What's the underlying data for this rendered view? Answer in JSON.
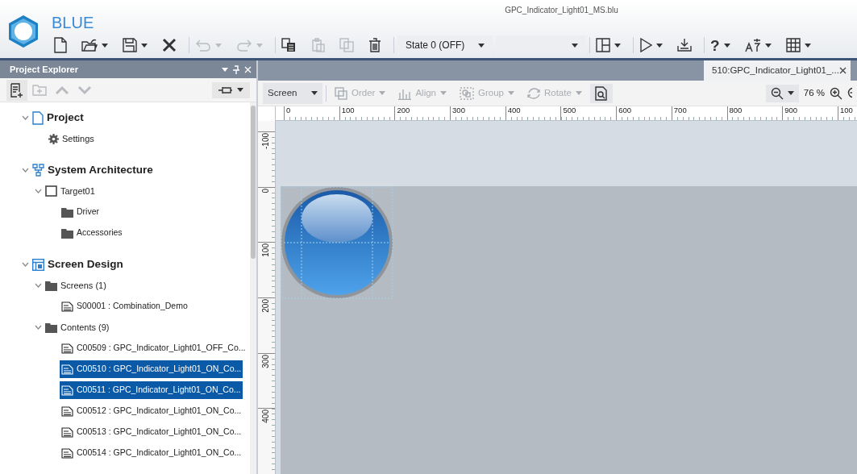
{
  "app": {
    "name": "BLUE",
    "file_title": "GPC_Indicator_Light01_MS.blu"
  },
  "toolbar": [
    {
      "kind": "new",
      "dropdown": false,
      "disabled": false
    },
    {
      "kind": "open",
      "dropdown": true,
      "disabled": false
    },
    {
      "kind": "save",
      "dropdown": true,
      "disabled": false
    },
    {
      "kind": "close",
      "dropdown": false,
      "disabled": false
    },
    {
      "kind": "separator"
    },
    {
      "kind": "undo",
      "dropdown": true,
      "disabled": true
    },
    {
      "kind": "redo",
      "dropdown": true,
      "disabled": true
    },
    {
      "kind": "separator"
    },
    {
      "kind": "copy",
      "dropdown": false,
      "disabled": false
    },
    {
      "kind": "paste",
      "dropdown": false,
      "disabled": true
    },
    {
      "kind": "duplicate",
      "dropdown": false,
      "disabled": true
    },
    {
      "kind": "delete",
      "dropdown": false,
      "disabled": false
    },
    {
      "kind": "separator"
    },
    {
      "kind": "select",
      "value": "State 0 (OFF)"
    },
    {
      "kind": "select"
    },
    {
      "kind": "separator"
    },
    {
      "kind": "layout",
      "dropdown": true,
      "disabled": false
    },
    {
      "kind": "separator"
    },
    {
      "kind": "run",
      "dropdown": true,
      "disabled": false
    },
    {
      "kind": "download",
      "dropdown": false,
      "disabled": false
    },
    {
      "kind": "separator"
    },
    {
      "kind": "help",
      "label": "?",
      "dropdown": true,
      "disabled": false
    },
    {
      "kind": "language",
      "dropdown": true,
      "disabled": false
    },
    {
      "kind": "grid",
      "dropdown": true,
      "disabled": false
    }
  ],
  "explorer": {
    "title": "Project Explorer",
    "toolbar": [
      {
        "kind": "new-item",
        "disabled": false
      },
      {
        "kind": "add-folder",
        "disabled": true
      },
      {
        "kind": "up",
        "disabled": true
      },
      {
        "kind": "down",
        "disabled": true
      }
    ],
    "tree": [
      {
        "label": "Project",
        "kind": "project",
        "expanded": true,
        "children": [
          {
            "label": "Settings",
            "kind": "settings",
            "selected": false
          }
        ]
      },
      {
        "label": "System Architecture",
        "kind": "architecture",
        "expanded": true,
        "children": [
          {
            "label": "Target01",
            "kind": "target",
            "expanded": true,
            "children": [
              {
                "label": "Driver",
                "kind": "folder",
                "selected": false
              },
              {
                "label": "Accessories",
                "kind": "folder",
                "selected": false
              }
            ]
          }
        ]
      },
      {
        "label": "Screen Design",
        "kind": "screen-design",
        "expanded": true,
        "children": [
          {
            "label": "Screens (1)",
            "kind": "folder",
            "expanded": true,
            "children": [
              {
                "label": "S00001 : Combination_Demo",
                "kind": "page",
                "selected": false
              }
            ]
          },
          {
            "label": "Contents (9)",
            "kind": "folder",
            "expanded": true,
            "children": [
              {
                "label": "C00509 : GPC_Indicator_Light01_OFF_Co...",
                "kind": "page",
                "selected": false
              },
              {
                "label": "C00510 : GPC_Indicator_Light01_ON_Co...",
                "kind": "page",
                "selected": true
              },
              {
                "label": "C00511 : GPC_Indicator_Light01_ON_Co...",
                "kind": "page",
                "selected": true
              },
              {
                "label": "C00512 : GPC_Indicator_Light01_ON_Co...",
                "kind": "page",
                "selected": false
              },
              {
                "label": "C00513 : GPC_Indicator_Light01_ON_Co...",
                "kind": "page",
                "selected": false
              },
              {
                "label": "C00514 : GPC_Indicator_Light01_ON_Co...",
                "kind": "page",
                "selected": false
              }
            ]
          }
        ]
      }
    ]
  },
  "editor": {
    "tabs": [
      {
        "label": "510:GPC_Indicator_Light01_...",
        "selected": true
      }
    ],
    "toolbar": [
      {
        "kind": "dropdown",
        "label": "Screen",
        "disabled": false
      },
      {
        "kind": "separator"
      },
      {
        "kind": "order",
        "label": "Order",
        "disabled": true
      },
      {
        "kind": "align",
        "label": "Align",
        "disabled": true
      },
      {
        "kind": "group",
        "label": "Group",
        "disabled": true
      },
      {
        "kind": "rotate",
        "label": "Rotate",
        "disabled": true
      },
      {
        "kind": "preview",
        "disabled": false
      }
    ],
    "zoom": "76 %",
    "hruler": [
      "0",
      "100",
      "200",
      "300",
      "400",
      "500",
      "600",
      "700",
      "800",
      "900",
      "100"
    ],
    "vruler": [
      "-100",
      "0",
      "100",
      "200",
      "300",
      "400"
    ]
  }
}
